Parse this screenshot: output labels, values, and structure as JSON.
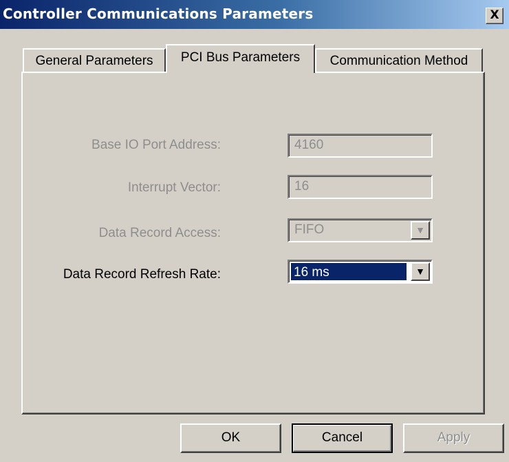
{
  "window": {
    "title": "Controller Communications Parameters",
    "close_glyph": "X"
  },
  "tabs": [
    {
      "label": "General Parameters",
      "active": false
    },
    {
      "label": "PCI Bus Parameters",
      "active": true
    },
    {
      "label": "Communication Method",
      "active": false
    }
  ],
  "fields": {
    "base_io": {
      "label": "Base IO Port Address:",
      "value": "4160",
      "enabled": false
    },
    "interrupt": {
      "label": "Interrupt Vector:",
      "value": "16",
      "enabled": false
    },
    "access": {
      "label": "Data Record Access:",
      "value": "FIFO",
      "enabled": false
    },
    "refresh": {
      "label": "Data Record Refresh Rate:",
      "value": "16 ms",
      "enabled": true
    }
  },
  "buttons": {
    "ok": "OK",
    "cancel": "Cancel",
    "apply": "Apply"
  },
  "icons": {
    "dropdown_glyph": "▼"
  },
  "colors": {
    "title_gradient_start": "#0a246a",
    "title_gradient_end": "#a6caf0",
    "dialog_face": "#d4d0c8",
    "selection": "#0a246a",
    "disabled_text": "#8e8e8e"
  }
}
